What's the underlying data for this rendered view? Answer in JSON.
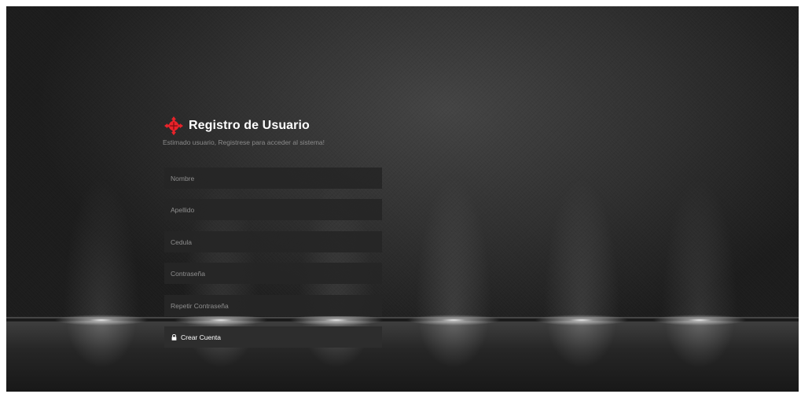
{
  "header": {
    "logo_icon": "red-cross-emblem-icon",
    "title": "Registro de Usuario",
    "subtitle": "Estimado usuario, Registrese para acceder al sistema!"
  },
  "form": {
    "fields": [
      {
        "name": "nombre",
        "placeholder": "Nombre",
        "value": ""
      },
      {
        "name": "apellido",
        "placeholder": "Apellido",
        "value": ""
      },
      {
        "name": "cedula",
        "placeholder": "Cedula",
        "value": ""
      },
      {
        "name": "contrasena",
        "placeholder": "Contraseña",
        "value": ""
      },
      {
        "name": "repetir-contrasena",
        "placeholder": "Repetir Contraseña",
        "value": ""
      }
    ],
    "submit": {
      "icon": "lock-icon",
      "label": "Crear Cuenta"
    }
  },
  "colors": {
    "accent": "#e8232a",
    "background": "#2f2f2f",
    "field_background": "#262626",
    "text": "#ffffff",
    "muted_text": "#8a8a8a"
  }
}
